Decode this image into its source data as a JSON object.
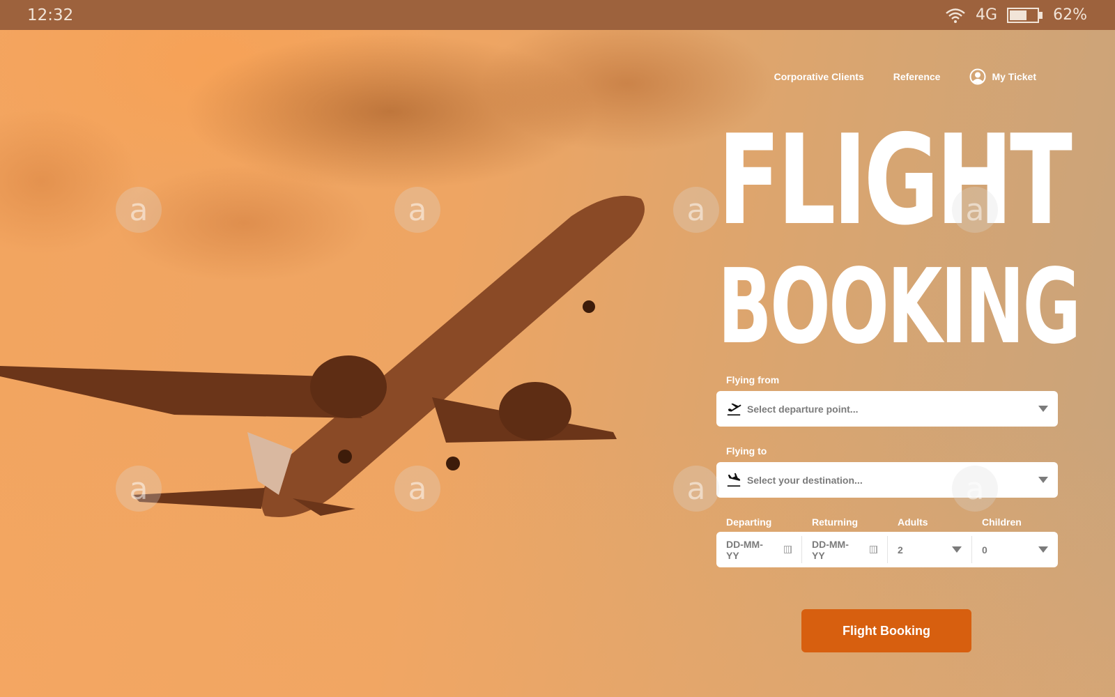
{
  "status_bar": {
    "time": "12:32",
    "network": "4G",
    "battery_percent_label": "62%",
    "battery_level": 0.62,
    "icons": [
      "wifi-icon",
      "battery-icon"
    ]
  },
  "nav": {
    "items": [
      {
        "label": "Corporative Clients"
      },
      {
        "label": "Reference"
      },
      {
        "label": "My Ticket",
        "icon": "user-circle-icon"
      }
    ]
  },
  "hero": {
    "line1": "FLIGHT",
    "line2": "BOOKING"
  },
  "form": {
    "from": {
      "label": "Flying from",
      "placeholder": "Select departure point...",
      "icon": "plane-takeoff-icon"
    },
    "to": {
      "label": "Flying to",
      "placeholder": "Select your destination...",
      "icon": "plane-landing-icon"
    },
    "departing": {
      "label": "Departing",
      "placeholder": "DD-MM-YY"
    },
    "returning": {
      "label": "Returning",
      "placeholder": "DD-MM-YY"
    },
    "adults": {
      "label": "Adults",
      "value": "2"
    },
    "children": {
      "label": "Children",
      "value": "0"
    },
    "submit_label": "Flight Booking"
  },
  "colors": {
    "status_bar": "#9d623d",
    "button": "#d75f0f",
    "placeholder_text": "#7b7b7b"
  }
}
